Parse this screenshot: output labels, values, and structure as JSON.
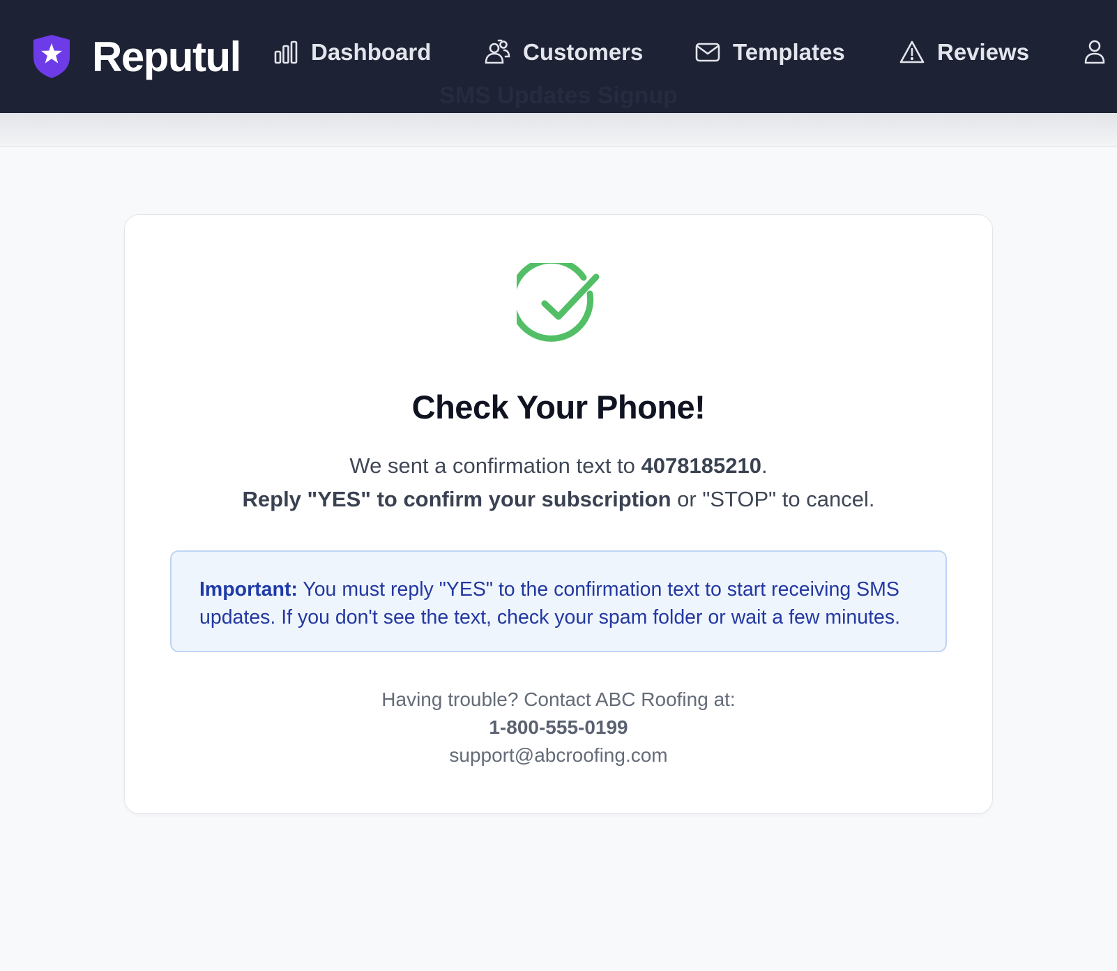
{
  "brand": {
    "name": "Reputul",
    "logo_icon": "shield-star-icon",
    "accent": "#6d3ce8"
  },
  "nav": {
    "items": [
      {
        "label": "Dashboard",
        "icon": "bar-chart-icon"
      },
      {
        "label": "Customers",
        "icon": "users-icon"
      },
      {
        "label": "Templates",
        "icon": "mail-icon"
      },
      {
        "label": "Reviews",
        "icon": "warning-triangle-icon"
      }
    ],
    "account_icon": "user-icon",
    "ghost_text": "SMS Updates Signup"
  },
  "card": {
    "status_icon": "check-circle-icon",
    "status_color": "#52bf66",
    "title": "Check Your Phone!",
    "line1_prefix": "We sent a confirmation text to ",
    "phone": "4078185210",
    "line1_suffix": ".",
    "line2_bold": "Reply \"YES\" to confirm your subscription",
    "line2_rest": " or \"STOP\" to cancel.",
    "notice": {
      "label": "Important:",
      "text": " You must reply \"YES\" to the confirmation text to start receiving SMS updates. If you don't see the text, check your spam folder or wait a few minutes."
    },
    "contact": {
      "intro": "Having trouble? Contact ABC Roofing at:",
      "phone": "1-800-555-0199",
      "email": "support@abcroofing.com"
    }
  }
}
